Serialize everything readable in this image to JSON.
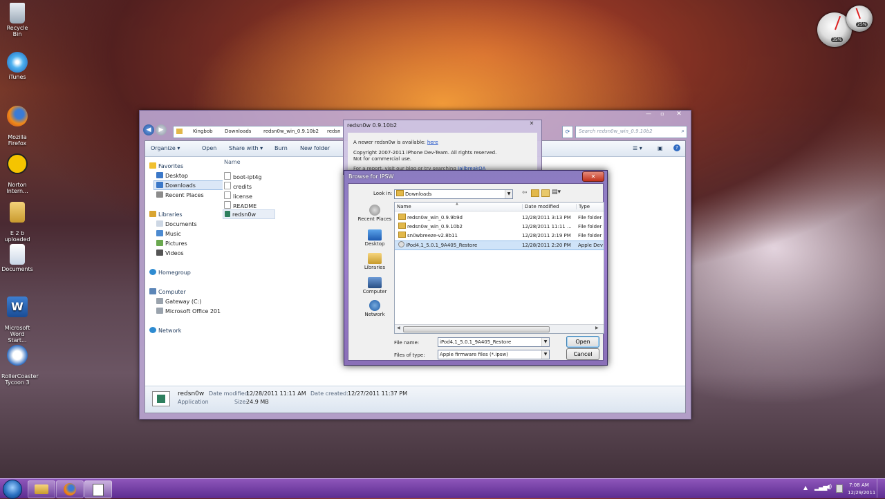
{
  "desktop": {
    "icons": [
      {
        "label": "Recycle Bin",
        "icon": "recycle-bin-icon"
      },
      {
        "label": "iTunes",
        "icon": "itunes-icon"
      },
      {
        "label": "Mozilla\nFirefox",
        "icon": "firefox-icon"
      },
      {
        "label": "Norton\nIntern...",
        "icon": "norton-icon"
      },
      {
        "label": "E 2 b\nuploaded",
        "icon": "folder-icon"
      },
      {
        "label": "Documents",
        "icon": "documents-icon"
      },
      {
        "label": "Microsoft\nWord Start...",
        "icon": "word-icon"
      },
      {
        "label": "RollerCoaster\nTycoon 3",
        "icon": "rollercoaster-icon"
      }
    ],
    "gadgets": {
      "cpu_percent": "35%",
      "mem_percent": "25%"
    }
  },
  "explorer": {
    "breadcrumb": [
      "Kingbob",
      "Downloads",
      "redsn0w_win_0.9.10b2",
      "redsn"
    ],
    "search_placeholder": "Search redsn0w_win_0.9.10b2",
    "toolbar": {
      "organize": "Organize ▾",
      "open": "Open",
      "share": "Share with ▾",
      "burn": "Burn",
      "new_folder": "New folder"
    },
    "nav": {
      "favorites": "Favorites",
      "desktop": "Desktop",
      "downloads": "Downloads",
      "recent": "Recent Places",
      "libraries": "Libraries",
      "documents": "Documents",
      "music": "Music",
      "pictures": "Pictures",
      "videos": "Videos",
      "homegroup": "Homegroup",
      "computer": "Computer",
      "gateway": "Gateway (C:)",
      "office": "Microsoft Office 201",
      "network": "Network"
    },
    "column_name": "Name",
    "files": [
      "boot-ipt4g",
      "credits",
      "license",
      "README",
      "redsn0w"
    ],
    "details": {
      "name": "redsn0w",
      "type": "Application",
      "modified_label": "Date modified:",
      "modified": "12/28/2011 11:11 AM",
      "created_label": "Date created:",
      "created": "12/27/2011 11:37 PM",
      "size_label": "Size:",
      "size": "24.9 MB"
    }
  },
  "redsn0w_dialog": {
    "title": "redsn0w 0.9.10b2",
    "available_text": "A newer redsn0w is available:",
    "available_link": "here",
    "copyright": "Copyright 2007-2011 iPhone Dev-Team. All rights reserved. Not for commercial use.",
    "report_text": "For a report, visit our blog or try searching",
    "report_link": "JailbreakQA"
  },
  "browse_dialog": {
    "title": "Browse for IPSW",
    "look_in_label": "Look in:",
    "look_in_value": "Downloads",
    "places": [
      "Recent Places",
      "Desktop",
      "Libraries",
      "Computer",
      "Network"
    ],
    "columns": {
      "name": "Name",
      "date": "Date modified",
      "type": "Type"
    },
    "rows": [
      {
        "name": "redsn0w_win_0.9.9b9d",
        "date": "12/28/2011 3:13 PM",
        "type": "File folder"
      },
      {
        "name": "redsn0w_win_0.9.10b2",
        "date": "12/28/2011 11:11 ...",
        "type": "File folder"
      },
      {
        "name": "sn0wbreeze-v2.8b11",
        "date": "12/28/2011 2:19 PM",
        "type": "File folder"
      },
      {
        "name": "iPod4,1_5.0.1_9A405_Restore",
        "date": "12/28/2011 2:20 PM",
        "type": "Apple Dev"
      }
    ],
    "file_name_label": "File name:",
    "file_name_value": "iPod4,1_5.0.1_9A405_Restore",
    "file_type_label": "Files of type:",
    "file_type_value": "Apple firmware files (*.ipsw)",
    "open": "Open",
    "cancel": "Cancel"
  },
  "taskbar": {
    "time": "7:08 AM",
    "date": "12/29/2011"
  }
}
